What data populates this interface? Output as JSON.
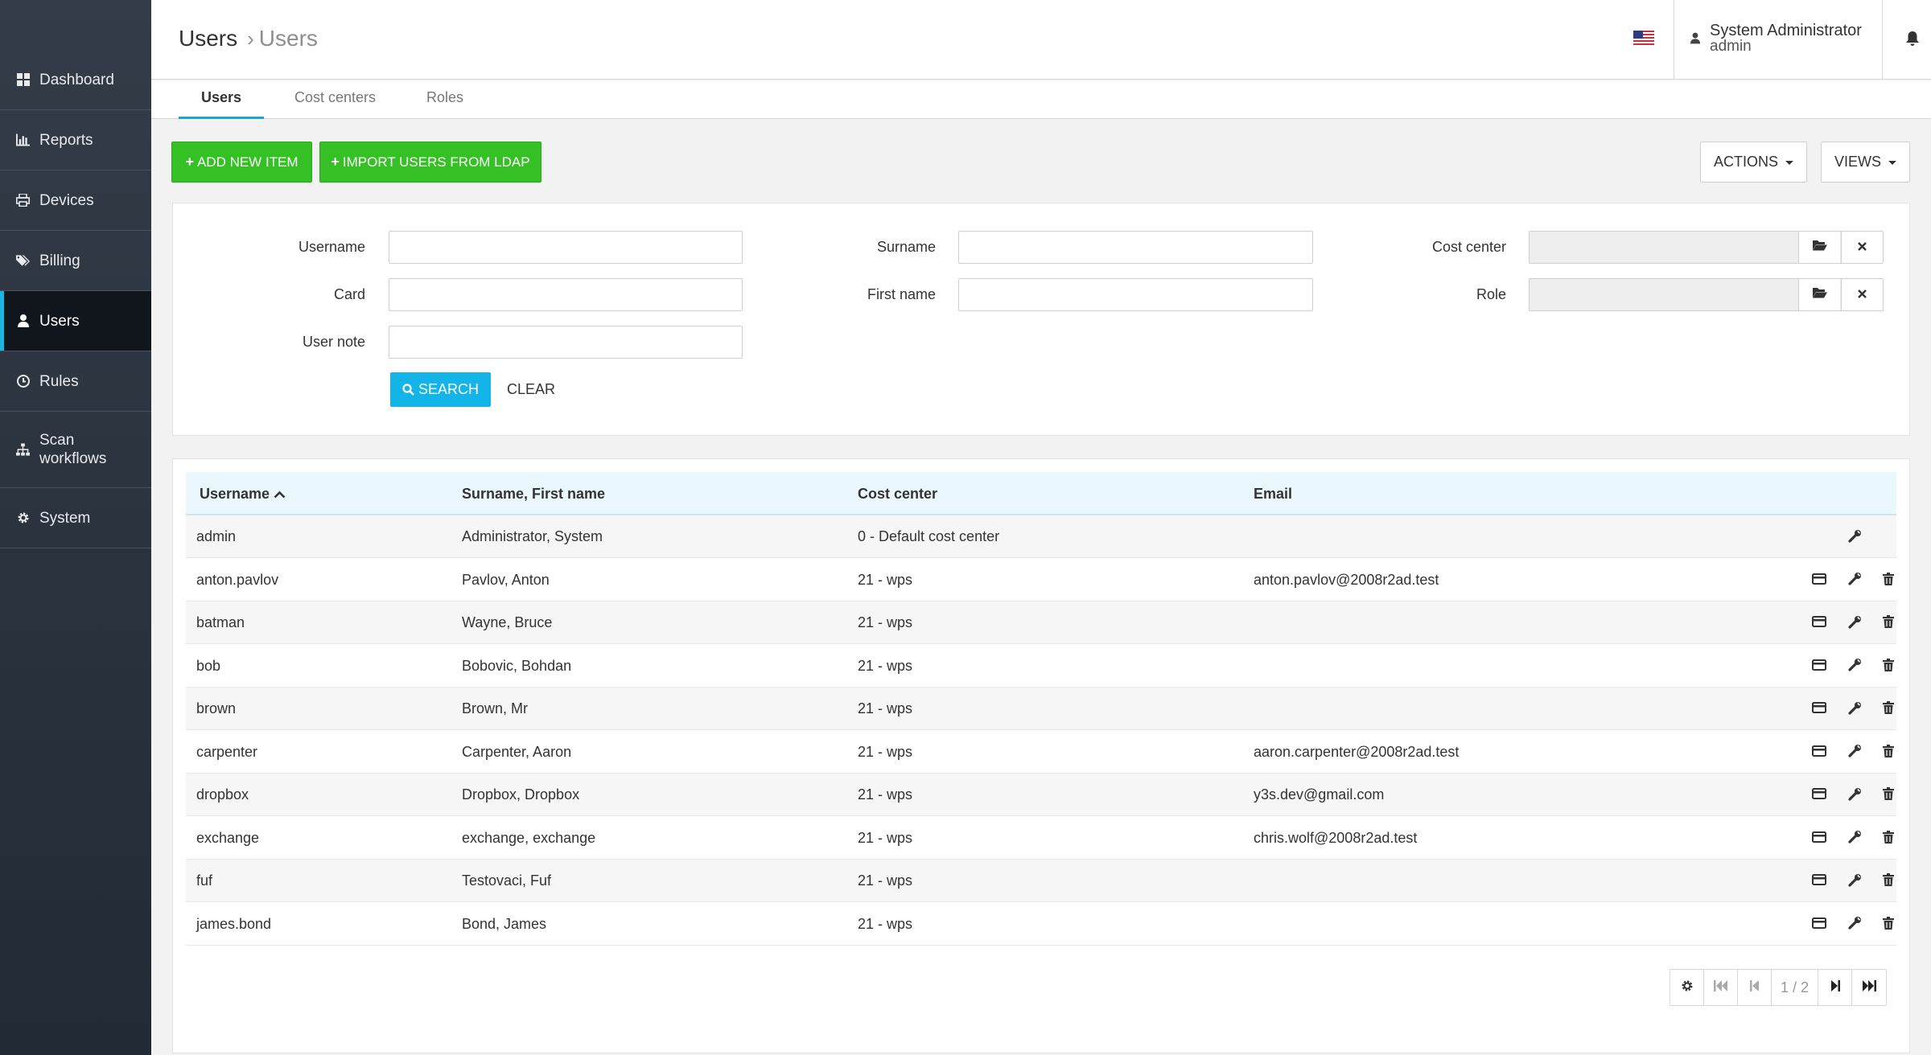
{
  "breadcrumb": {
    "root": "Users",
    "current": "Users"
  },
  "user": {
    "name": "System Administrator",
    "login": "admin"
  },
  "sidebar": {
    "items": [
      {
        "label": "Dashboard",
        "icon": "dashboard-icon"
      },
      {
        "label": "Reports",
        "icon": "bar-chart-icon"
      },
      {
        "label": "Devices",
        "icon": "printer-icon"
      },
      {
        "label": "Billing",
        "icon": "tags-icon"
      },
      {
        "label": "Users",
        "icon": "user-icon",
        "active": true
      },
      {
        "label": "Rules",
        "icon": "clock-icon"
      },
      {
        "label": "Scan workflows",
        "icon": "sitemap-icon"
      },
      {
        "label": "System",
        "icon": "gear-icon"
      }
    ]
  },
  "tabs": [
    {
      "label": "Users",
      "active": true
    },
    {
      "label": "Cost centers"
    },
    {
      "label": "Roles"
    }
  ],
  "toolbar": {
    "add_label": "ADD NEW ITEM",
    "import_label": "IMPORT USERS FROM LDAP",
    "actions_label": "ACTIONS",
    "views_label": "VIEWS"
  },
  "filters": {
    "username": {
      "label": "Username",
      "value": ""
    },
    "card": {
      "label": "Card",
      "value": ""
    },
    "user_note": {
      "label": "User note",
      "value": ""
    },
    "surname": {
      "label": "Surname",
      "value": ""
    },
    "first_name": {
      "label": "First name",
      "value": ""
    },
    "cost_center": {
      "label": "Cost center",
      "value": ""
    },
    "role": {
      "label": "Role",
      "value": ""
    },
    "search_label": "SEARCH",
    "clear_label": "CLEAR"
  },
  "table": {
    "columns": [
      "Username",
      "Surname, First name",
      "Cost center",
      "Email"
    ],
    "rows": [
      {
        "username": "admin",
        "name": "Administrator, System",
        "cost_center": "0 - Default cost center",
        "email": ""
      },
      {
        "username": "anton.pavlov",
        "name": "Pavlov, Anton",
        "cost_center": "21 - wps",
        "email": "anton.pavlov@2008r2ad.test"
      },
      {
        "username": "batman",
        "name": "Wayne, Bruce",
        "cost_center": "21 - wps",
        "email": ""
      },
      {
        "username": "bob",
        "name": "Bobovic, Bohdan",
        "cost_center": "21 - wps",
        "email": ""
      },
      {
        "username": "brown",
        "name": "Brown, Mr",
        "cost_center": "21 - wps",
        "email": ""
      },
      {
        "username": "carpenter",
        "name": "Carpenter, Aaron",
        "cost_center": "21 - wps",
        "email": "aaron.carpenter@2008r2ad.test"
      },
      {
        "username": "dropbox",
        "name": "Dropbox, Dropbox",
        "cost_center": "21 - wps",
        "email": "y3s.dev@gmail.com"
      },
      {
        "username": "exchange",
        "name": "exchange, exchange",
        "cost_center": "21 - wps",
        "email": "chris.wolf@2008r2ad.test"
      },
      {
        "username": "fuf",
        "name": "Testovaci, Fuf",
        "cost_center": "21 - wps",
        "email": ""
      },
      {
        "username": "james.bond",
        "name": "Bond, James",
        "cost_center": "21 - wps",
        "email": ""
      }
    ]
  },
  "pager": {
    "info": "1 / 2"
  },
  "colors": {
    "accent": "#19b6e3",
    "green": "#35c025",
    "sidebar": "#2c3440"
  }
}
